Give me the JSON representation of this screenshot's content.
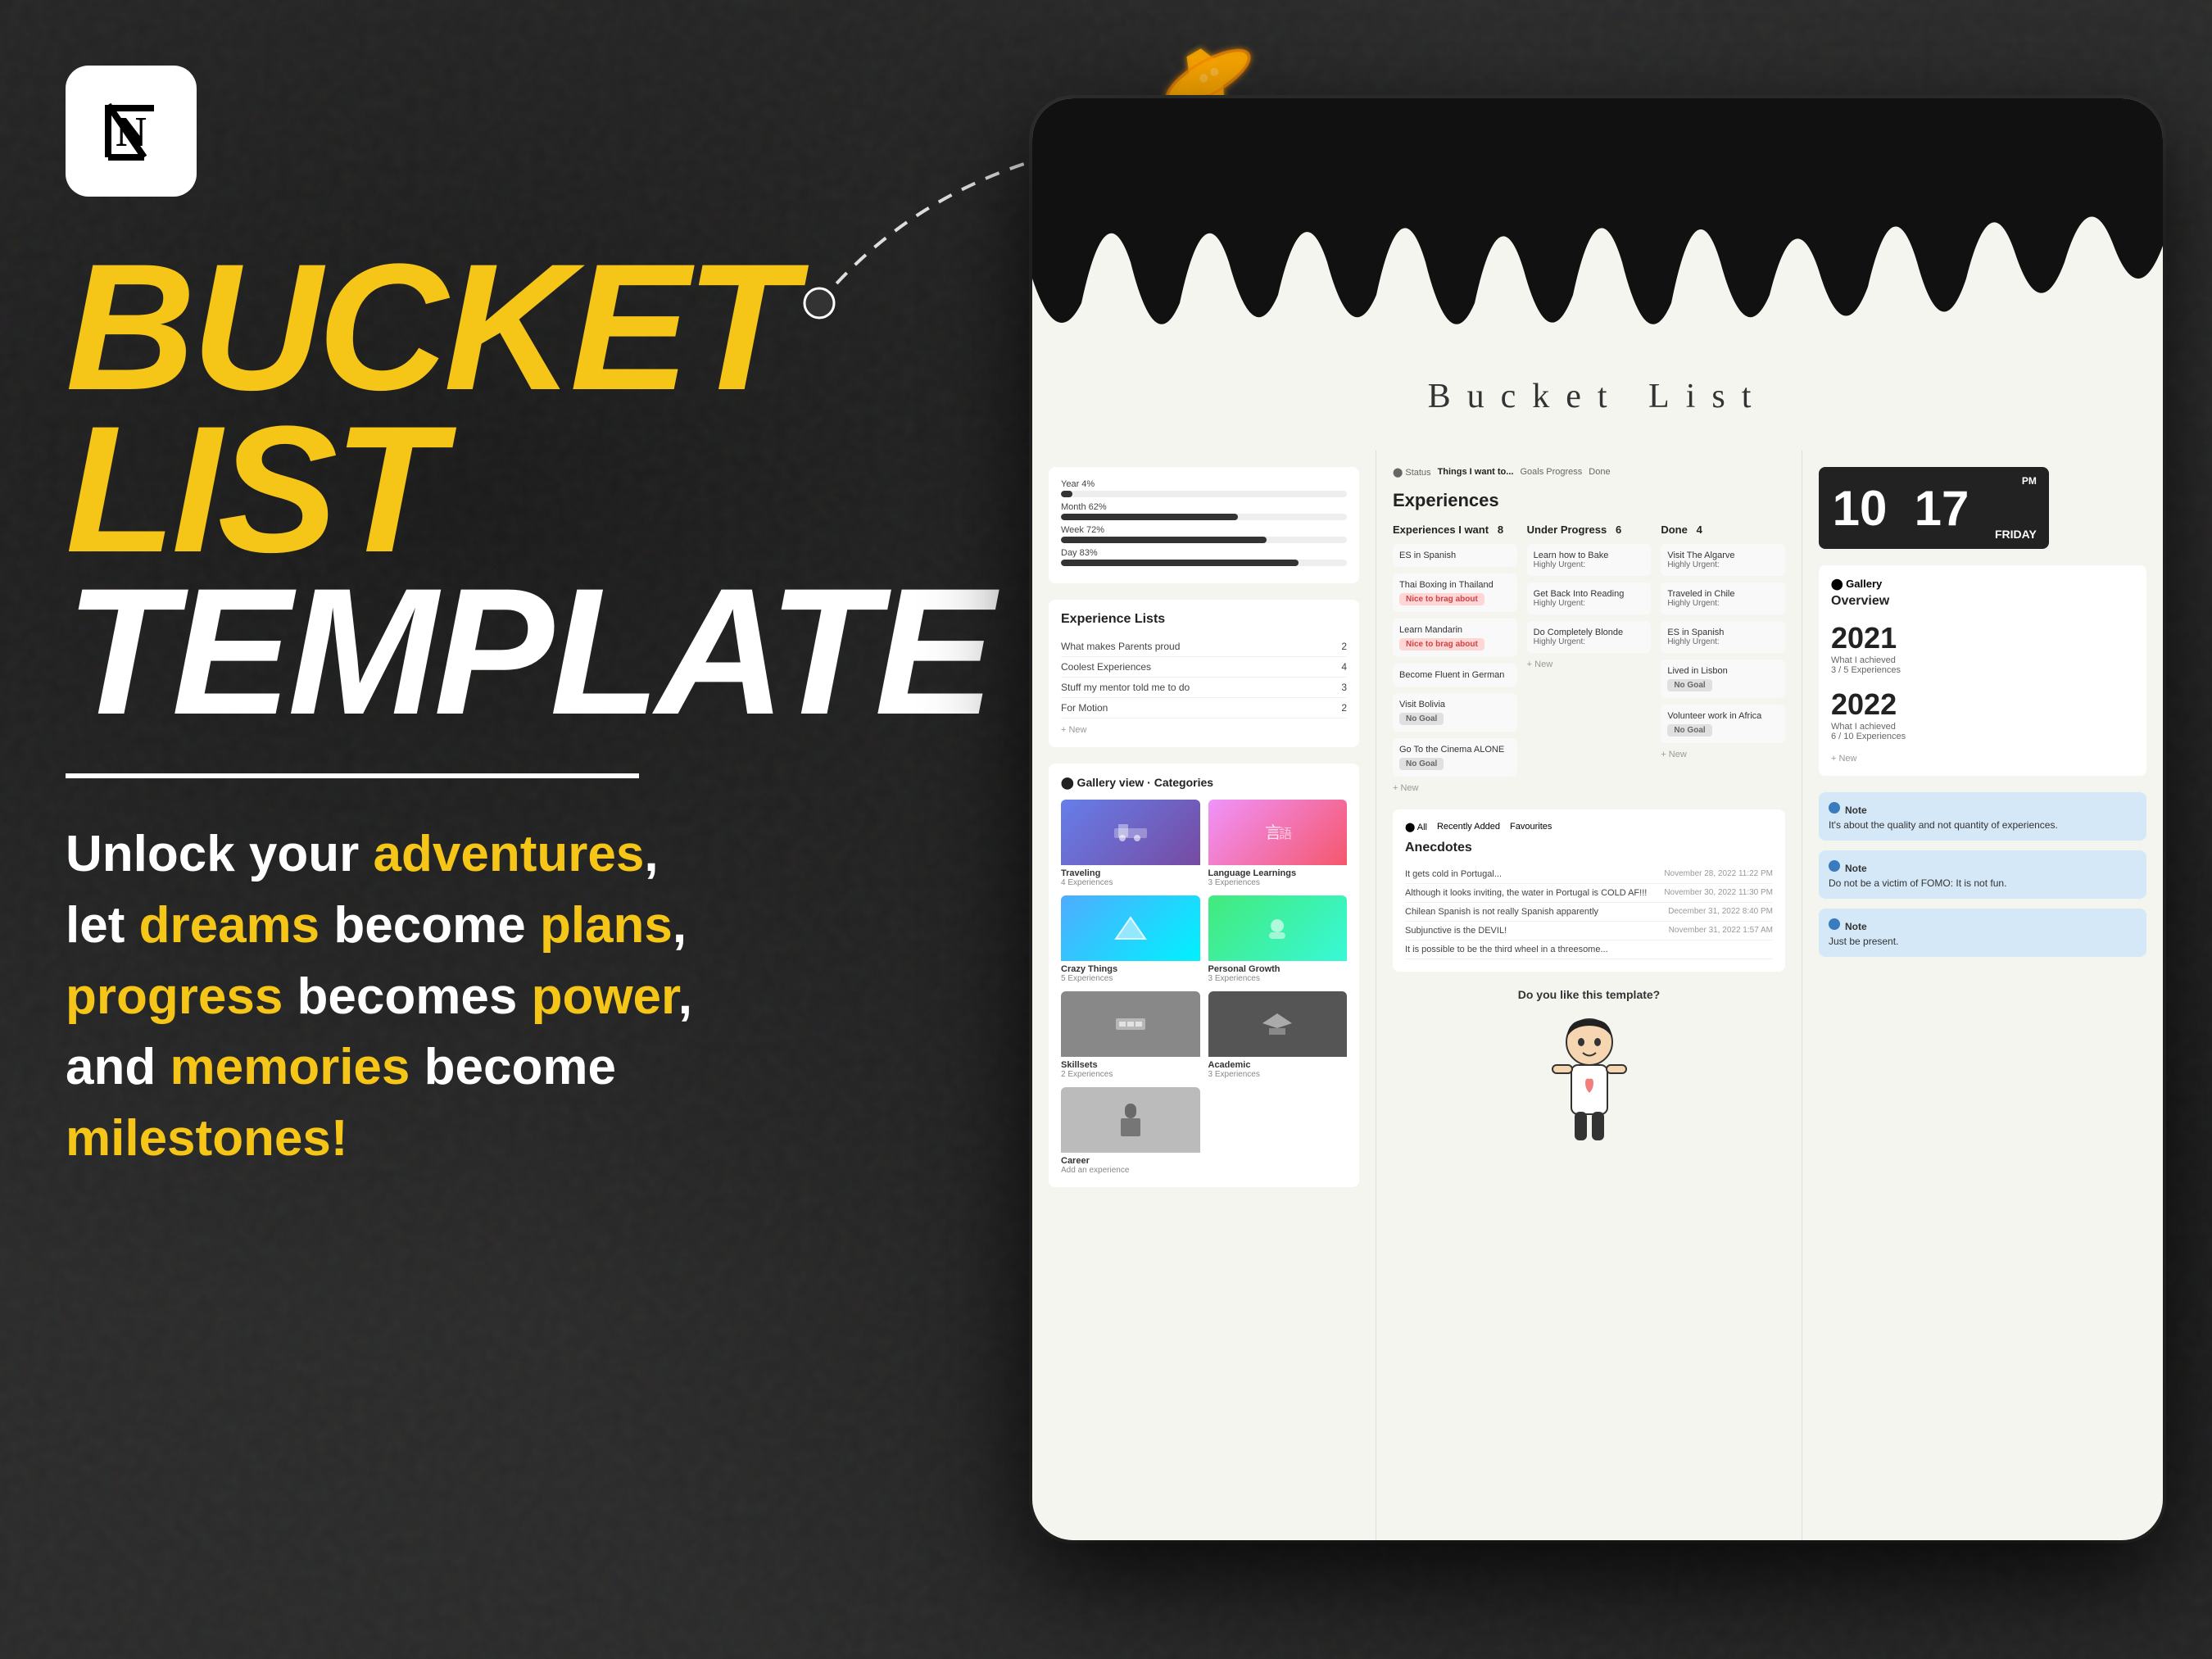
{
  "page": {
    "title": "Bucket List Template",
    "background_color": "#2a2a2a"
  },
  "left_panel": {
    "logo_alt": "Notion Logo",
    "title_line1": "BUCKET",
    "title_line2": "LIST",
    "title_line3": "TEMPLATE",
    "divider": true,
    "subtitle_parts": [
      {
        "text": "Unlock your ",
        "highlight": false
      },
      {
        "text": "adventures",
        "highlight": true
      },
      {
        "text": ", let ",
        "highlight": false
      },
      {
        "text": "dreams",
        "highlight": true
      },
      {
        "text": " become ",
        "highlight": false
      },
      {
        "text": "plans",
        "highlight": true
      },
      {
        "text": ", ",
        "highlight": false
      },
      {
        "text": "progress",
        "highlight": true
      },
      {
        "text": " becomes ",
        "highlight": false
      },
      {
        "text": "power",
        "highlight": true
      },
      {
        "text": ", and ",
        "highlight": false
      },
      {
        "text": "memories",
        "highlight": true
      },
      {
        "text": " become ",
        "highlight": false
      },
      {
        "text": "milestones!",
        "highlight": true
      }
    ]
  },
  "tablet": {
    "title": "Bucket  List",
    "header_tabs": [
      "Status",
      "Things I want to...",
      "Goals Progress",
      "Done"
    ],
    "experiences_title": "Experiences",
    "kanban_columns": [
      {
        "title": "Experiences I want",
        "count": "8",
        "cards": [
          {
            "text": "ES in Spanish",
            "badge": "",
            "badge_type": ""
          },
          {
            "text": "Thai Boxing in Thailand",
            "badge": "Nice to brag about",
            "badge_type": "pink"
          },
          {
            "text": "Learn Mandarin",
            "badge": "Nice to brag about",
            "badge_type": "pink"
          },
          {
            "text": "Become Fluent in German",
            "badge": "",
            "badge_type": ""
          },
          {
            "text": "Visit Bolivia",
            "badge": "No Goal",
            "badge_type": "gray"
          },
          {
            "text": "Go To the Cinema ALONE",
            "badge": "No Goal",
            "badge_type": "gray"
          }
        ]
      },
      {
        "title": "Under Progress",
        "count": "6",
        "cards": [
          {
            "text": "Learn how to Bake",
            "badge": "Highly Urgent",
            "badge_type": "pink"
          },
          {
            "text": "Get Back Into Reading",
            "badge": "Highly Urgent",
            "badge_type": "pink"
          },
          {
            "text": "Do Completely Blonde",
            "badge": "Highly Urgent",
            "badge_type": "pink"
          },
          {
            "text": "+ New",
            "badge": "",
            "badge_type": ""
          }
        ]
      },
      {
        "title": "Done",
        "count": "4",
        "cards": [
          {
            "text": "Visit The Algarve",
            "badge": "Highly Urgent",
            "badge_type": "pink"
          },
          {
            "text": "Traveled in Chile",
            "badge": "Highly Urgent",
            "badge_type": "pink"
          },
          {
            "text": "ES in Spanish",
            "badge": "Highly Urgent",
            "badge_type": "pink"
          },
          {
            "text": "Lived in Lisbon",
            "badge": "No Goal",
            "badge_type": "gray"
          },
          {
            "text": "Volunteer work in Africa",
            "badge": "No Goal",
            "badge_type": "gray"
          }
        ]
      }
    ],
    "progress_items": [
      {
        "label": "Year 4%",
        "value": 4
      },
      {
        "label": "Month 62%",
        "value": 62
      },
      {
        "label": "Week 72%",
        "value": 72
      },
      {
        "label": "Day 83%",
        "value": 83
      }
    ],
    "experience_lists_title": "Experience Lists",
    "experience_lists": [
      {
        "name": "What makes Parents proud",
        "count": 2
      },
      {
        "name": "Coolest Experiences",
        "count": 4
      },
      {
        "name": "Stuff my mentor told me to do",
        "count": 3
      },
      {
        "name": "For Motion",
        "count": 2
      }
    ],
    "gallery_categories": [
      {
        "name": "Traveling",
        "count": "4 Experiences",
        "color": "dark"
      },
      {
        "name": "Language Learnings",
        "count": "3 Experiences",
        "color": "medium"
      },
      {
        "name": "Crazy Things",
        "count": "5 Experiences",
        "color": "darker"
      },
      {
        "name": "Personal Growth",
        "count": "3 Experiences",
        "color": "light"
      },
      {
        "name": "Skillsets",
        "count": "2 Experiences",
        "color": "medium"
      },
      {
        "name": "Academic",
        "count": "3 Experiences",
        "color": "darker"
      },
      {
        "name": "Career",
        "count": "Add an experience",
        "color": "career"
      }
    ],
    "anecdotes_title": "Anecdotes",
    "anecdotes_tabs": [
      "All",
      "Recently Added",
      "Favourites"
    ],
    "anecdotes": [
      {
        "text": "It gets cold in Portugal...",
        "date": "November 28, 2022 11:22 PM"
      },
      {
        "text": "Although it looks inviting, the water in Portugal is COLD AF!!!",
        "date": "November 30, 2022 11:30 PM"
      },
      {
        "text": "Chilean Spanish is not really Spanish apparently",
        "date": "December 31, 2022 8:40 PM"
      },
      {
        "text": "Subjunctive is the DEVIL!",
        "date": "November 31, 2022 1:57 AM"
      },
      {
        "text": "It is possible to be the third wheel in a threesome...",
        "date": ""
      }
    ],
    "char_question": "Do you like this template?",
    "clock_hour": "10",
    "clock_minute": "17",
    "clock_am": "PM",
    "clock_day": "FRIDAY",
    "gallery_overview_title": "Gallery",
    "gallery_overview_subtitle": "Overview",
    "years": [
      {
        "year": "2021",
        "stat_label": "What I achieved",
        "stat_value": "3 / 5 Experiences"
      },
      {
        "year": "2022",
        "stat_label": "What I achieved",
        "stat_value": "6 / 10 Experiences"
      }
    ],
    "notes": [
      {
        "text": "It's about the quality and not quantity of experiences."
      },
      {
        "text": "Do not be a victim of FOMO: It is not fun."
      },
      {
        "text": "Just be present."
      }
    ],
    "thailand_text": "Thailand"
  }
}
